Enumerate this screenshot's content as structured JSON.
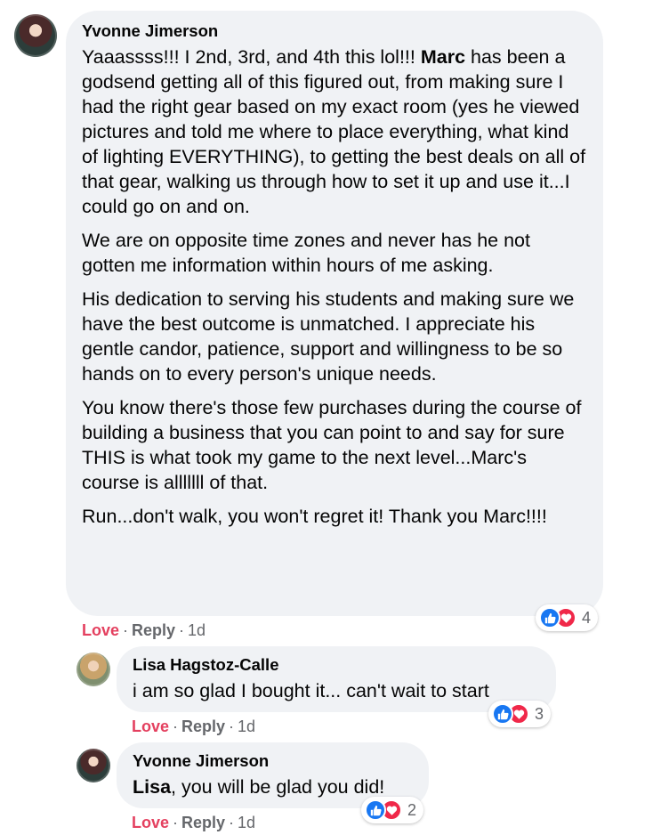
{
  "comments": [
    {
      "author": "Yvonne Jimerson",
      "paragraphs": [
        {
          "before": "Yaaassss!!! I 2nd, 3rd, and 4th this lol!!! ",
          "mention": "Marc",
          "after": " has been a godsend getting all of this figured out, from making sure I had the right gear based on my exact room (yes he viewed pictures and told me where to place everything, what kind of lighting EVERYTHING), to getting the best deals on all of that gear, walking us through how to set it up and use it...I could go on and on."
        },
        {
          "before": "We are on opposite time zones and never has he not gotten me information within hours of me asking.",
          "mention": "",
          "after": ""
        },
        {
          "before": "His dedication to serving his students and making sure we have the best outcome is unmatched. I appreciate his gentle candor, patience, support and willingness to be so hands on to every person's unique needs.",
          "mention": "",
          "after": ""
        },
        {
          "before": "You know there's those few purchases during the course of building a business that you can point to and say for sure THIS is what took my game to the next level...Marc's course is alllllll of that.",
          "mention": "",
          "after": ""
        },
        {
          "before": "Run...don't walk, you won't regret it! Thank you Marc!!!!",
          "mention": "",
          "after": ""
        }
      ],
      "actions": {
        "love": "Love",
        "reply": "Reply",
        "time": "1d",
        "sep": "·"
      },
      "reaction_count": "4"
    },
    {
      "author": "Lisa Hagstoz-Calle",
      "text": "i am so glad I bought it... can't wait to start",
      "actions": {
        "love": "Love",
        "reply": "Reply",
        "time": "1d",
        "sep": "·"
      },
      "reaction_count": "3"
    },
    {
      "author": "Yvonne Jimerson",
      "mention": "Lisa",
      "text": ", you will be glad you did!",
      "actions": {
        "love": "Love",
        "reply": "Reply",
        "time": "1d",
        "sep": "·"
      },
      "reaction_count": "2"
    }
  ],
  "icons": {
    "like": "thumbs-up-icon",
    "love": "heart-icon"
  },
  "colors": {
    "bubble": "#f0f2f5",
    "love_action": "#e4405f",
    "like_reaction": "#1877f2",
    "love_reaction": "#f02849",
    "meta_text": "#65676b"
  }
}
